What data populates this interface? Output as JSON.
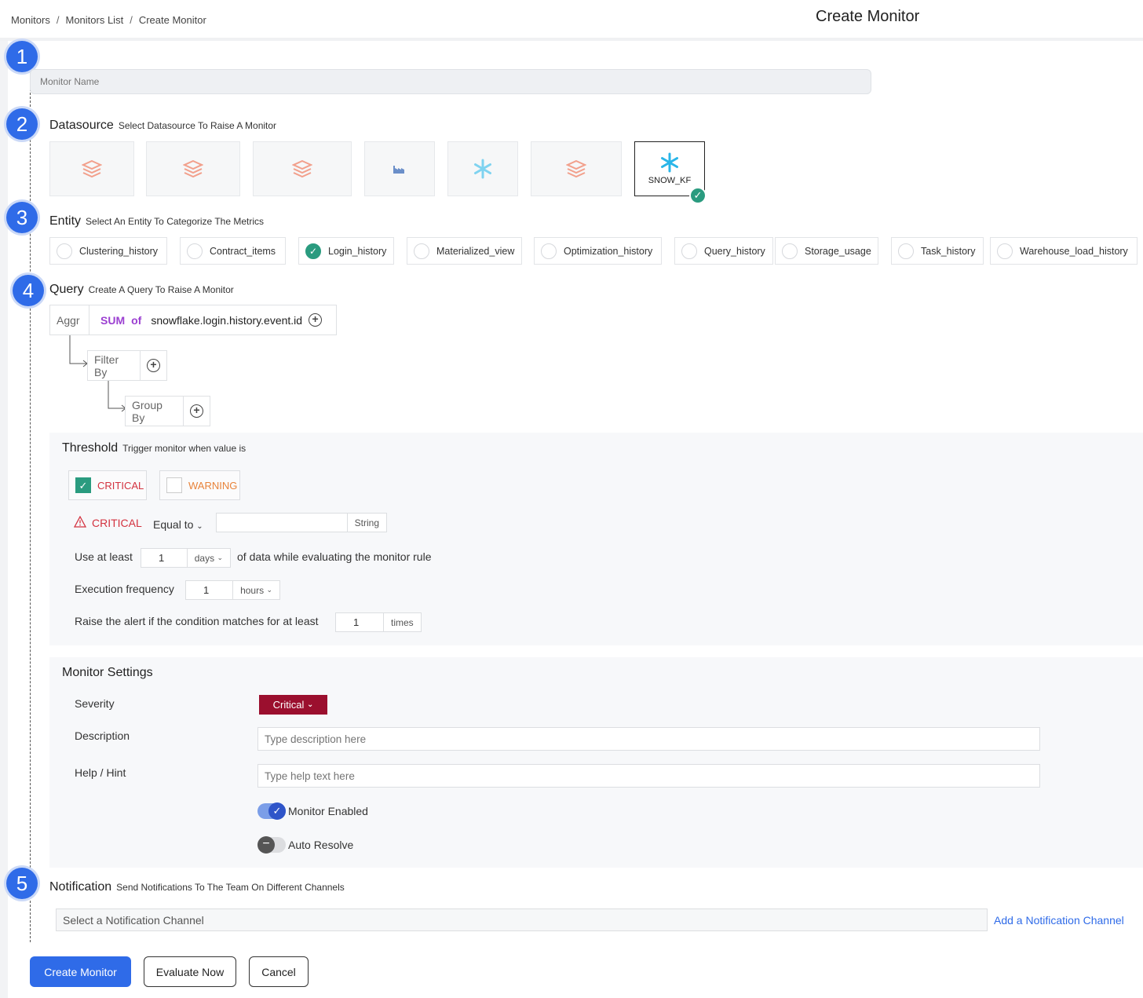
{
  "breadcrumb": [
    "Monitors",
    "Monitors List",
    "Create Monitor"
  ],
  "page_title": "Create Monitor",
  "steps": [
    "1",
    "2",
    "3",
    "4",
    "5"
  ],
  "monitor_name": {
    "placeholder": "Monitor Name"
  },
  "datasource": {
    "title": "Datasource",
    "subtitle": "Select Datasource To Raise A Monitor",
    "cards": [
      {
        "icon": "layers-icon",
        "label": ""
      },
      {
        "icon": "layers-icon",
        "label": ""
      },
      {
        "icon": "layers-icon",
        "label": ""
      },
      {
        "icon": "factory-icon",
        "label": ""
      },
      {
        "icon": "snowflake-icon",
        "label": ""
      },
      {
        "icon": "layers-icon",
        "label": ""
      },
      {
        "icon": "snowflake-icon",
        "label": "SNOW_KF",
        "selected": true
      }
    ]
  },
  "entity": {
    "title": "Entity",
    "subtitle": "Select An Entity To Categorize The Metrics",
    "items": [
      "Clustering_history",
      "Contract_items",
      "Login_history",
      "Materialized_view",
      "Optimization_history",
      "Query_history",
      "Storage_usage",
      "Task_history",
      "Warehouse_load_history"
    ],
    "selected": "Login_history"
  },
  "query": {
    "title": "Query",
    "subtitle": "Create A Query To Raise A Monitor",
    "aggr_label": "Aggr",
    "aggr_fn": "SUM",
    "of": "of",
    "field": "snowflake.login.history.event.id",
    "filter_by": "Filter By",
    "group_by": "Group By"
  },
  "threshold": {
    "title": "Threshold",
    "subtitle": "Trigger monitor when value is",
    "critical_label": "CRITICAL",
    "critical_checked": true,
    "warning_label": "WARNING",
    "warning_checked": false,
    "condition_label": "CRITICAL",
    "operator": "Equal to",
    "value": "",
    "value_type": "String",
    "use_at_least_label": "Use at least",
    "use_at_least_value": "1",
    "use_at_least_unit": "days",
    "use_at_least_suffix": "of data while evaluating the monitor rule",
    "exec_freq_label": "Execution frequency",
    "exec_freq_value": "1",
    "exec_freq_unit": "hours",
    "raise_label": "Raise the alert if the condition matches for at least",
    "raise_value": "1",
    "raise_unit": "times"
  },
  "settings": {
    "title": "Monitor Settings",
    "severity_label": "Severity",
    "severity_value": "Critical",
    "description_label": "Description",
    "description_placeholder": "Type description here",
    "hint_label": "Help / Hint",
    "hint_placeholder": "Type help text here",
    "monitor_enabled_label": "Monitor Enabled",
    "monitor_enabled": true,
    "auto_resolve_label": "Auto Resolve",
    "auto_resolve": false
  },
  "notification": {
    "title": "Notification",
    "subtitle": "Send Notifications To The Team On Different Channels",
    "placeholder": "Select a Notification Channel",
    "add_link": "Add a Notification Channel"
  },
  "buttons": {
    "create": "Create Monitor",
    "evaluate": "Evaluate Now",
    "cancel": "Cancel"
  },
  "colors": {
    "step_blue": "#2f6be8",
    "check_green": "#2a9b7f",
    "critical_red": "#d3323f",
    "warning_orange": "#e8833a",
    "severity_bg": "#9b0f2e",
    "primary_button": "#2f6be8",
    "snowflake_blue": "#29b5e8",
    "layers_salmon": "#f2a08c"
  }
}
